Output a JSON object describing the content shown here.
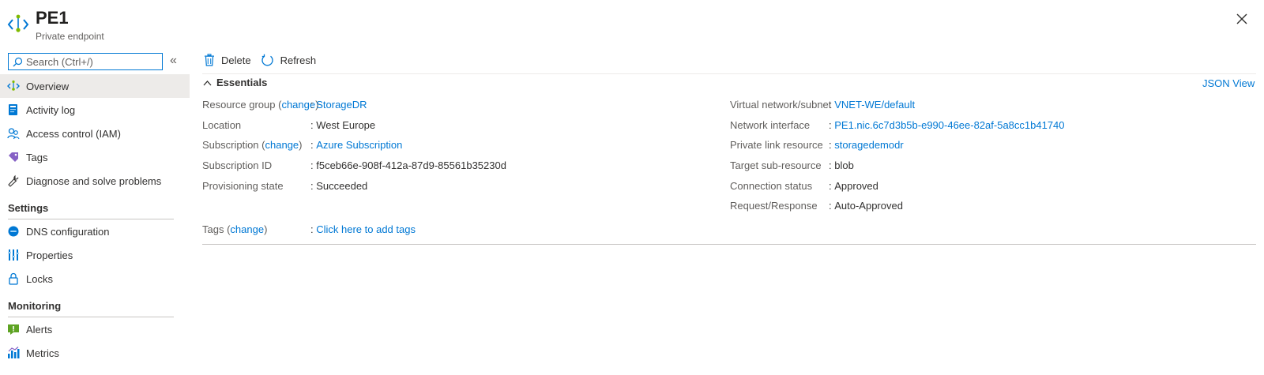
{
  "header": {
    "title": "PE1",
    "subtitle": "Private endpoint",
    "resource_icon": "private-endpoint-icon",
    "close_icon": "close-icon"
  },
  "search": {
    "placeholder": "Search (Ctrl+/)",
    "value": "",
    "collapse_glyph": "«"
  },
  "sidebar": {
    "items": [
      {
        "label": "Overview",
        "icon": "overview-icon",
        "active": true
      },
      {
        "label": "Activity log",
        "icon": "activity-log-icon"
      },
      {
        "label": "Access control (IAM)",
        "icon": "access-control-icon"
      },
      {
        "label": "Tags",
        "icon": "tag-icon"
      },
      {
        "label": "Diagnose and solve problems",
        "icon": "wrench-icon"
      }
    ],
    "sections": [
      {
        "title": "Settings",
        "items": [
          {
            "label": "DNS configuration",
            "icon": "dns-icon"
          },
          {
            "label": "Properties",
            "icon": "properties-icon"
          },
          {
            "label": "Locks",
            "icon": "lock-icon"
          }
        ]
      },
      {
        "title": "Monitoring",
        "items": [
          {
            "label": "Alerts",
            "icon": "alert-icon"
          },
          {
            "label": "Metrics",
            "icon": "metrics-icon"
          }
        ]
      }
    ]
  },
  "toolbar": {
    "delete_label": "Delete",
    "refresh_label": "Refresh"
  },
  "essentials": {
    "label": "Essentials",
    "json_view": "JSON View",
    "change_text": "change",
    "left": [
      {
        "label": "Resource group",
        "value": "StorageDR",
        "link": true,
        "change": true
      },
      {
        "label": "Location",
        "value": "West Europe",
        "link": false
      },
      {
        "label": "Subscription",
        "value": "Azure Subscription",
        "link": true,
        "change": true
      },
      {
        "label": "Subscription ID",
        "value": "f5ceb66e-908f-412a-87d9-85561b35230d",
        "link": false
      },
      {
        "label": "Provisioning state",
        "value": "Succeeded",
        "link": false
      }
    ],
    "right": [
      {
        "label": "Virtual network/subnet",
        "value": "VNET-WE/default",
        "link": true
      },
      {
        "label": "Network interface",
        "value": "PE1.nic.6c7d3b5b-e990-46ee-82af-5a8cc1b41740",
        "link": true
      },
      {
        "label": "Private link resource",
        "value": "storagedemodr",
        "link": true
      },
      {
        "label": "Target sub-resource",
        "value": "blob",
        "link": false
      },
      {
        "label": "Connection status",
        "value": "Approved",
        "link": false
      },
      {
        "label": "Request/Response",
        "value": "Auto-Approved",
        "link": false
      }
    ],
    "tags": {
      "label": "Tags",
      "value": "Click here to add tags"
    }
  },
  "colors": {
    "accent": "#0078d4",
    "active_bg": "#edebe9",
    "text": "#323130",
    "muted": "#605e5c"
  }
}
